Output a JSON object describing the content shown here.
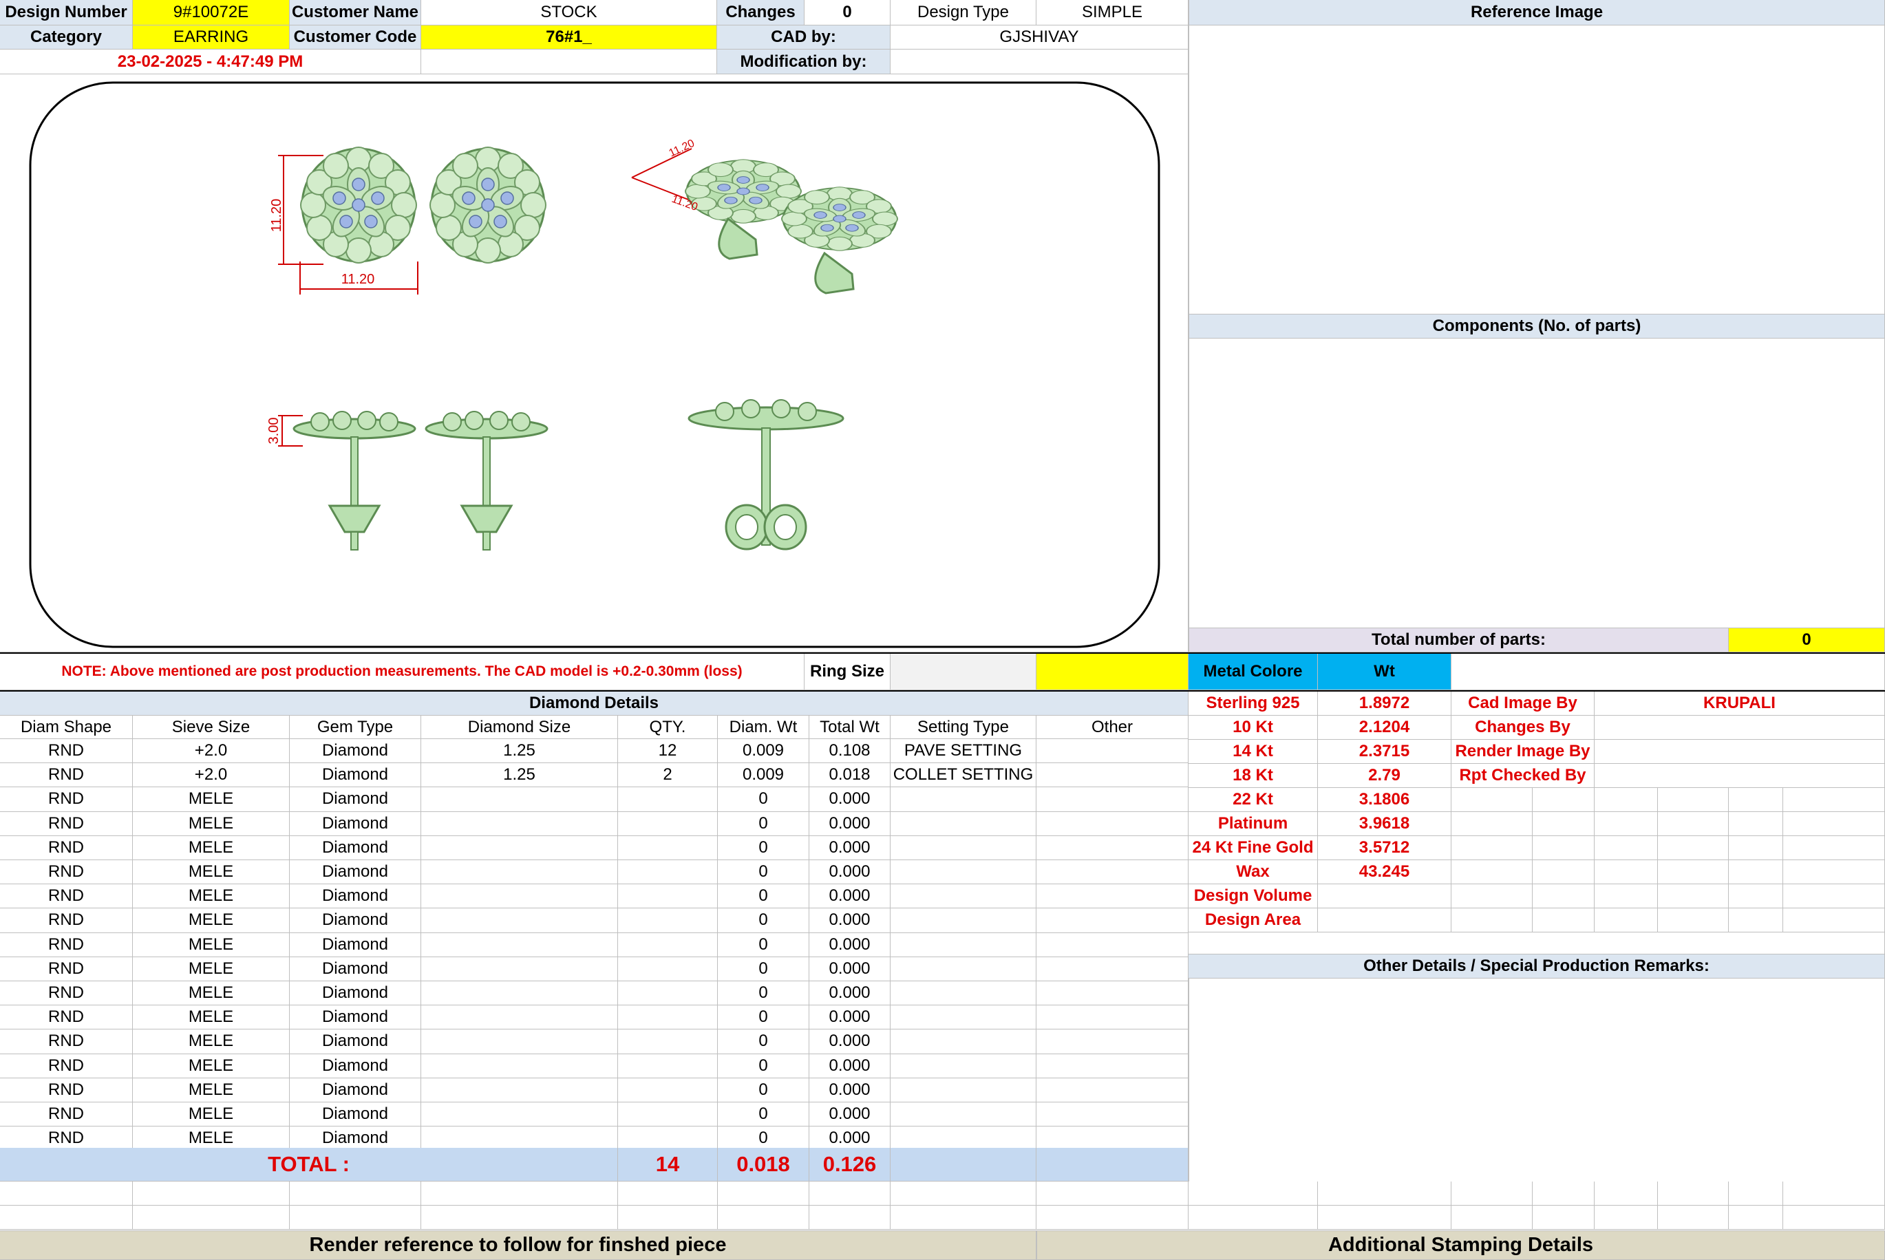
{
  "header": {
    "design_number_label": "Design Number",
    "design_number": "9#10072E",
    "customer_name_label": "Customer Name",
    "customer_name": "STOCK",
    "changes_label": "Changes",
    "changes": "0",
    "design_type_label": "Design Type",
    "design_type": "SIMPLE",
    "category_label": "Category",
    "category": "EARRING",
    "customer_code_label": "Customer Code",
    "customer_code": "76#1_",
    "cad_by_label": "CAD by:",
    "cad_by": "GJSHIVAY",
    "timestamp": "23-02-2025 - 4:47:49 PM",
    "modification_by_label": "Modification by:"
  },
  "drawing": {
    "dim_width": "11.20",
    "dim_height": "11.20",
    "dim_depth": "3.00",
    "persp_dim_a": "11.20",
    "persp_dim_b": "11.20"
  },
  "right_panel": {
    "reference_image_label": "Reference Image",
    "components_label": "Components (No. of parts)",
    "total_parts_label": "Total number of parts:",
    "total_parts": "0"
  },
  "note": {
    "text": "NOTE: Above mentioned are post production measurements. The CAD model is +0.2-0.30mm (loss)",
    "ring_size_label": "Ring Size"
  },
  "diamond": {
    "title": "Diamond Details",
    "columns": [
      "Diam Shape",
      "Sieve Size",
      "Gem Type",
      "Diamond Size",
      "QTY.",
      "Diam. Wt",
      "Total Wt",
      "Setting Type",
      "Other"
    ],
    "rows": [
      [
        "RND",
        "+2.0",
        "Diamond",
        "1.25",
        "12",
        "0.009",
        "0.108",
        "PAVE SETTING",
        ""
      ],
      [
        "RND",
        "+2.0",
        "Diamond",
        "1.25",
        "2",
        "0.009",
        "0.018",
        "COLLET SETTING",
        ""
      ],
      [
        "RND",
        "MELE",
        "Diamond",
        "",
        "",
        "0",
        "0.000",
        "",
        ""
      ],
      [
        "RND",
        "MELE",
        "Diamond",
        "",
        "",
        "0",
        "0.000",
        "",
        ""
      ],
      [
        "RND",
        "MELE",
        "Diamond",
        "",
        "",
        "0",
        "0.000",
        "",
        ""
      ],
      [
        "RND",
        "MELE",
        "Diamond",
        "",
        "",
        "0",
        "0.000",
        "",
        ""
      ],
      [
        "RND",
        "MELE",
        "Diamond",
        "",
        "",
        "0",
        "0.000",
        "",
        ""
      ],
      [
        "RND",
        "MELE",
        "Diamond",
        "",
        "",
        "0",
        "0.000",
        "",
        ""
      ],
      [
        "RND",
        "MELE",
        "Diamond",
        "",
        "",
        "0",
        "0.000",
        "",
        ""
      ],
      [
        "RND",
        "MELE",
        "Diamond",
        "",
        "",
        "0",
        "0.000",
        "",
        ""
      ],
      [
        "RND",
        "MELE",
        "Diamond",
        "",
        "",
        "0",
        "0.000",
        "",
        ""
      ],
      [
        "RND",
        "MELE",
        "Diamond",
        "",
        "",
        "0",
        "0.000",
        "",
        ""
      ],
      [
        "RND",
        "MELE",
        "Diamond",
        "",
        "",
        "0",
        "0.000",
        "",
        ""
      ],
      [
        "RND",
        "MELE",
        "Diamond",
        "",
        "",
        "0",
        "0.000",
        "",
        ""
      ],
      [
        "RND",
        "MELE",
        "Diamond",
        "",
        "",
        "0",
        "0.000",
        "",
        ""
      ],
      [
        "RND",
        "MELE",
        "Diamond",
        "",
        "",
        "0",
        "0.000",
        "",
        ""
      ],
      [
        "RND",
        "MELE",
        "Diamond",
        "",
        "",
        "0",
        "0.000",
        "",
        ""
      ]
    ],
    "total_label": "TOTAL :",
    "total_qty": "14",
    "total_diam_wt": "0.018",
    "total_wt": "0.126"
  },
  "metal": {
    "col_label": "Metal Colore",
    "wt_label": "Wt",
    "rows": [
      [
        "Sterling 925",
        "1.8972"
      ],
      [
        "10 Kt",
        "2.1204"
      ],
      [
        "14 Kt",
        "2.3715"
      ],
      [
        "18 Kt",
        "2.79"
      ],
      [
        "22 Kt",
        "3.1806"
      ],
      [
        "Platinum",
        "3.9618"
      ],
      [
        "24 Kt Fine Gold",
        "3.5712"
      ],
      [
        "Wax",
        "43.245"
      ],
      [
        "Design Volume",
        ""
      ],
      [
        "Design Area",
        ""
      ]
    ],
    "credits": [
      [
        "Cad Image By",
        "KRUPALI"
      ],
      [
        "Changes By",
        ""
      ],
      [
        "Render Image By",
        ""
      ],
      [
        "Rpt Checked By",
        ""
      ]
    ]
  },
  "other_details_label": "Other Details / Special Production Remarks:",
  "footer": {
    "render_note": "Render reference to follow for finshed piece",
    "stamping": "Additional Stamping Details"
  },
  "colors": {
    "header_blue": "#dce6f1",
    "highlight_yellow": "#ffff00",
    "metal_blue": "#00b0f0",
    "total_blue": "#c5d9f1",
    "label_red": "#e00000",
    "model_green": "#b9e0b0"
  }
}
